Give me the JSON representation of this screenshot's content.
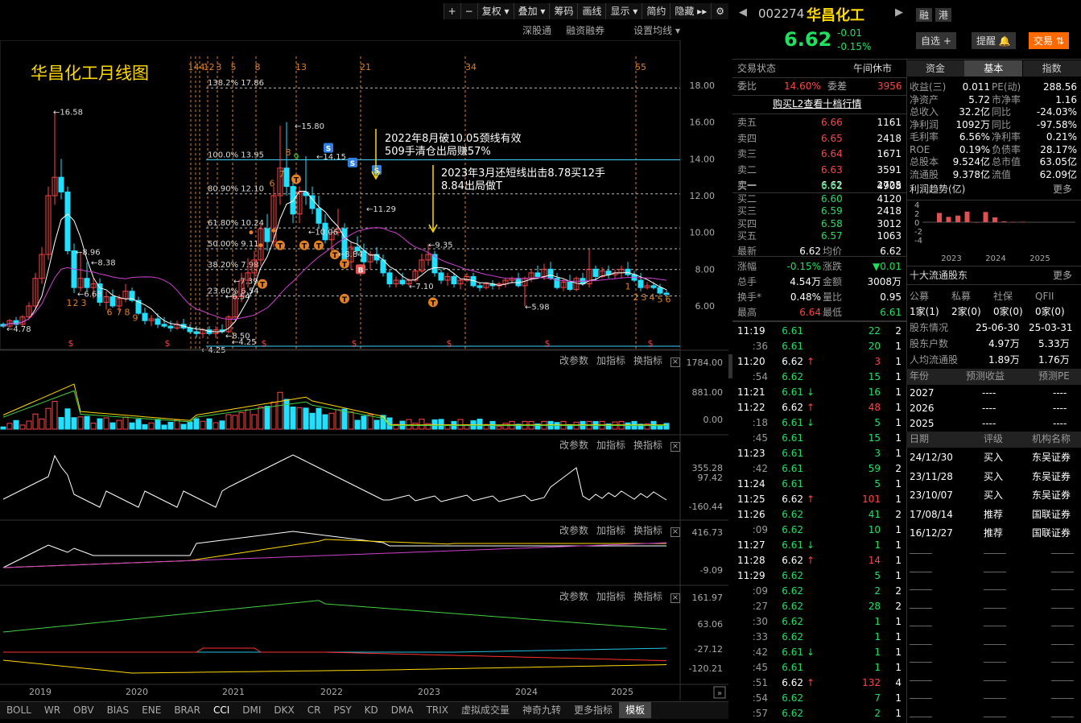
{
  "toolbar": {
    "plus": "+",
    "minus": "−",
    "restore": "复权",
    "overlay": "叠加",
    "chips": "筹码",
    "draw": "画线",
    "display": "显示",
    "simple": "简约",
    "hide": "隐藏"
  },
  "subbar": {
    "shen": "深股通",
    "margin": "融资融券",
    "ma": "设置均线"
  },
  "chart": {
    "title": "华昌化工月线图",
    "fib_numbers": [
      "144",
      "1",
      "2",
      "3",
      "5",
      "8",
      "13",
      "21",
      "34",
      "55"
    ],
    "y_labels": [
      "18.00",
      "16.00",
      "14.00",
      "12.00",
      "10.00",
      "8.00",
      "6.00"
    ],
    "fib_lines": [
      {
        "label": "138.2% 17.86"
      },
      {
        "label": "100.0% 13.95"
      },
      {
        "label": "80.90% 12.10"
      },
      {
        "label": "61.80% 10.24"
      },
      {
        "label": "50.00% 9.11"
      },
      {
        "label": "38.20% 7.98"
      },
      {
        "label": "23.60% 6.54"
      }
    ],
    "annotations": {
      "a1_line1": "2022年8月破10.05颈线有效",
      "a1_line2": "509手清仓出局赚57%",
      "a2_line1": "2023年3月还短线出击8.78买12手",
      "a2_line2": "8.84出局做T"
    },
    "price_marks": [
      "16.58",
      "8.96",
      "8.38",
      "15.80",
      "14.15",
      "11.29",
      "10.06",
      "9.35",
      "7.10",
      "5.98",
      "4.78",
      "4.25",
      "4.25",
      "7.39",
      "6.54",
      "8.84",
      "6.68",
      "8.50"
    ],
    "x_labels": [
      "2019",
      "2020",
      "2021",
      "2022",
      "2023",
      "2024",
      "2025"
    ],
    "count_labels_red": [
      "7",
      "8",
      "6",
      "1",
      "2",
      "3",
      "6",
      "7",
      "8",
      "9",
      "1",
      "2",
      "3",
      "4",
      "5",
      "6"
    ],
    "count_green": "9"
  },
  "panels": [
    {
      "params": "改参数",
      "add": "加指标",
      "switch": "换指标",
      "y": [
        "1784.00",
        "881.00",
        "0.00"
      ]
    },
    {
      "params": "改参数",
      "add": "加指标",
      "switch": "换指标",
      "y": [
        "355.28",
        "97.42",
        "-160.44"
      ]
    },
    {
      "params": "改参数",
      "add": "加指标",
      "switch": "换指标",
      "y": [
        "416.73",
        "-9.09"
      ]
    },
    {
      "params": "改参数",
      "add": "加指标",
      "switch": "换指标",
      "y": [
        "161.97",
        "63.06",
        "-27.12",
        "-120.21"
      ]
    }
  ],
  "indicators": [
    "BOLL",
    "WR",
    "OBV",
    "BIAS",
    "ENE",
    "BRAR",
    "CCI",
    "DMI",
    "DKX",
    "CR",
    "PSY",
    "KD",
    "DMA",
    "TRIX",
    "虚拟成交量",
    "神奇九转",
    "更多指标",
    "模板"
  ],
  "stock": {
    "code": "002274",
    "name": "华昌化工",
    "price": "6.62",
    "change": "-0.01",
    "pct": "-0.15%",
    "rong": "融",
    "gang": "港",
    "zixuan": "自选 +",
    "tixing": "提醒",
    "jiaoyi": "交易"
  },
  "status": {
    "label": "交易状态",
    "value": "午间休市"
  },
  "weibi": {
    "label": "委比",
    "value": "14.60%",
    "diff_label": "委差",
    "diff": "3956"
  },
  "l2": "购买L2查看十档行情",
  "asks": [
    {
      "name": "卖五",
      "price": "6.66",
      "vol": "1161"
    },
    {
      "name": "卖四",
      "price": "6.65",
      "vol": "2418"
    },
    {
      "name": "卖三",
      "price": "6.64",
      "vol": "1671"
    },
    {
      "name": "卖二",
      "price": "6.63",
      "vol": "3591"
    },
    {
      "name": "卖一",
      "price": "6.62",
      "vol": "2725"
    }
  ],
  "bids": [
    {
      "name": "买一",
      "price": "6.61",
      "vol": "4908"
    },
    {
      "name": "买二",
      "price": "6.60",
      "vol": "4120"
    },
    {
      "name": "买三",
      "price": "6.59",
      "vol": "2418"
    },
    {
      "name": "买四",
      "price": "6.58",
      "vol": "3012"
    },
    {
      "name": "买五",
      "price": "6.57",
      "vol": "1063"
    }
  ],
  "quote": [
    {
      "l1": "最新",
      "v1": "6.62",
      "l2": "均价",
      "v2": "6.62"
    },
    {
      "l1": "涨幅",
      "v1": "-0.15%",
      "l2": "涨跌",
      "v2": "▼0.01"
    },
    {
      "l1": "总手",
      "v1": "4.54万",
      "l2": "金额",
      "v2": "3008万"
    },
    {
      "l1": "换手*",
      "v1": "0.48%",
      "l2": "量比",
      "v2": "0.95"
    },
    {
      "l1": "最高",
      "v1": "6.64",
      "l2": "最低",
      "v2": "6.61"
    }
  ],
  "ticks": [
    {
      "t": "11:19",
      "p": "6.61",
      "a": "",
      "v": "22",
      "n": "2"
    },
    {
      "t": ":36",
      "p": "6.61",
      "a": "",
      "v": "20",
      "n": "1"
    },
    {
      "t": "11:20",
      "p": "6.62",
      "a": "up",
      "v": "3",
      "n": "1"
    },
    {
      "t": ":54",
      "p": "6.62",
      "a": "",
      "v": "15",
      "n": "1"
    },
    {
      "t": "11:21",
      "p": "6.61",
      "a": "down",
      "v": "16",
      "n": "1"
    },
    {
      "t": "11:22",
      "p": "6.62",
      "a": "up",
      "v": "48",
      "n": "1"
    },
    {
      "t": ":18",
      "p": "6.61",
      "a": "down",
      "v": "5",
      "n": "1"
    },
    {
      "t": ":45",
      "p": "6.61",
      "a": "",
      "v": "15",
      "n": "1"
    },
    {
      "t": "11:23",
      "p": "6.61",
      "a": "",
      "v": "3",
      "n": "1"
    },
    {
      "t": ":42",
      "p": "6.61",
      "a": "",
      "v": "59",
      "n": "2"
    },
    {
      "t": "11:24",
      "p": "6.61",
      "a": "",
      "v": "5",
      "n": "1"
    },
    {
      "t": "11:25",
      "p": "6.62",
      "a": "up",
      "v": "101",
      "n": "1"
    },
    {
      "t": "11:26",
      "p": "6.62",
      "a": "",
      "v": "41",
      "n": "2"
    },
    {
      "t": ":09",
      "p": "6.62",
      "a": "",
      "v": "10",
      "n": "1"
    },
    {
      "t": "11:27",
      "p": "6.61",
      "a": "down",
      "v": "1",
      "n": "1"
    },
    {
      "t": "11:28",
      "p": "6.62",
      "a": "up",
      "v": "14",
      "n": "1"
    },
    {
      "t": "11:29",
      "p": "6.62",
      "a": "",
      "v": "5",
      "n": "1"
    },
    {
      "t": ":09",
      "p": "6.62",
      "a": "",
      "v": "2",
      "n": "2"
    },
    {
      "t": ":27",
      "p": "6.62",
      "a": "",
      "v": "28",
      "n": "2"
    },
    {
      "t": ":30",
      "p": "6.62",
      "a": "",
      "v": "1",
      "n": "1"
    },
    {
      "t": ":33",
      "p": "6.62",
      "a": "",
      "v": "1",
      "n": "1"
    },
    {
      "t": ":42",
      "p": "6.61",
      "a": "down",
      "v": "1",
      "n": "1"
    },
    {
      "t": ":45",
      "p": "6.61",
      "a": "",
      "v": "1",
      "n": "1"
    },
    {
      "t": ":51",
      "p": "6.62",
      "a": "up",
      "v": "132",
      "n": "4"
    },
    {
      "t": ":54",
      "p": "6.62",
      "a": "",
      "v": "7",
      "n": "1"
    },
    {
      "t": ":57",
      "p": "6.62",
      "a": "",
      "v": "2",
      "n": "1"
    }
  ],
  "tabs": [
    "资金",
    "基本",
    "指数"
  ],
  "fund": [
    {
      "l1": "收益(三)",
      "v1": "0.011",
      "l2": "PE(动)",
      "v2": "288.56"
    },
    {
      "l1": "净资产",
      "v1": "5.72",
      "l2": "市净率",
      "v2": "1.16"
    },
    {
      "l1": "总收入",
      "v1": "32.2亿",
      "l2": "同比",
      "v2": "-24.03%"
    },
    {
      "l1": "净利润",
      "v1": "1092万",
      "l2": "同比",
      "v2": "-97.58%"
    },
    {
      "l1": "毛利率",
      "v1": "6.56%",
      "l2": "净利率",
      "v2": "0.21%"
    },
    {
      "l1": "ROE",
      "v1": "0.19%",
      "l2": "负债率",
      "v2": "28.17%"
    },
    {
      "l1": "总股本",
      "v1": "9.524亿",
      "l2": "总市值",
      "v2": "63.05亿"
    },
    {
      "l1": "流通股",
      "v1": "9.378亿",
      "l2": "流值",
      "v2": "62.09亿"
    }
  ],
  "profit": {
    "title": "利润趋势(亿)",
    "more": "更多",
    "y": [
      "4",
      "2",
      "0",
      "-2",
      "-4"
    ],
    "x": [
      "2023",
      "2024",
      "2025"
    ],
    "bars": [
      2.1,
      1.2,
      1.5,
      2.4,
      0,
      2.3,
      1.1,
      0.2,
      0.05,
      0.1
    ]
  },
  "holders": {
    "title": "十大流通股东",
    "more": "更多",
    "cols": [
      "公募",
      "私募",
      "社保",
      "QFII"
    ],
    "vals": [
      "1家(1)",
      "2家(0)",
      "0家(0)",
      "0家(0)"
    ],
    "dates_label": "股东情况",
    "d1": "25-06-30",
    "d2": "25-03-31",
    "count_label": "股东户数",
    "c1": "4.97万",
    "c2": "5.33万",
    "avg_label": "人均流通股",
    "a1": "1.89万",
    "a2": "1.76万"
  },
  "forecast": {
    "h1": "年份",
    "h2": "预测收益",
    "h3": "预测PE",
    "rows": [
      {
        "y": "2027",
        "e": "----",
        "p": "----"
      },
      {
        "y": "2026",
        "e": "----",
        "p": "----"
      },
      {
        "y": "2025",
        "e": "----",
        "p": "----"
      }
    ]
  },
  "ratings": {
    "h1": "日期",
    "h2": "评级",
    "h3": "机构名称",
    "rows": [
      {
        "d": "24/12/30",
        "r": "买入",
        "o": "东吴证券"
      },
      {
        "d": "23/11/28",
        "r": "买入",
        "o": "东吴证券"
      },
      {
        "d": "23/10/07",
        "r": "买入",
        "o": "东吴证券"
      },
      {
        "d": "17/08/14",
        "r": "推荐",
        "o": "国联证券"
      },
      {
        "d": "16/12/27",
        "r": "推荐",
        "o": "国联证券"
      }
    ]
  },
  "colors": {
    "up": "#ff4444",
    "down": "#20e0ff",
    "bg": "#000000",
    "accent": "#ff6a00"
  }
}
